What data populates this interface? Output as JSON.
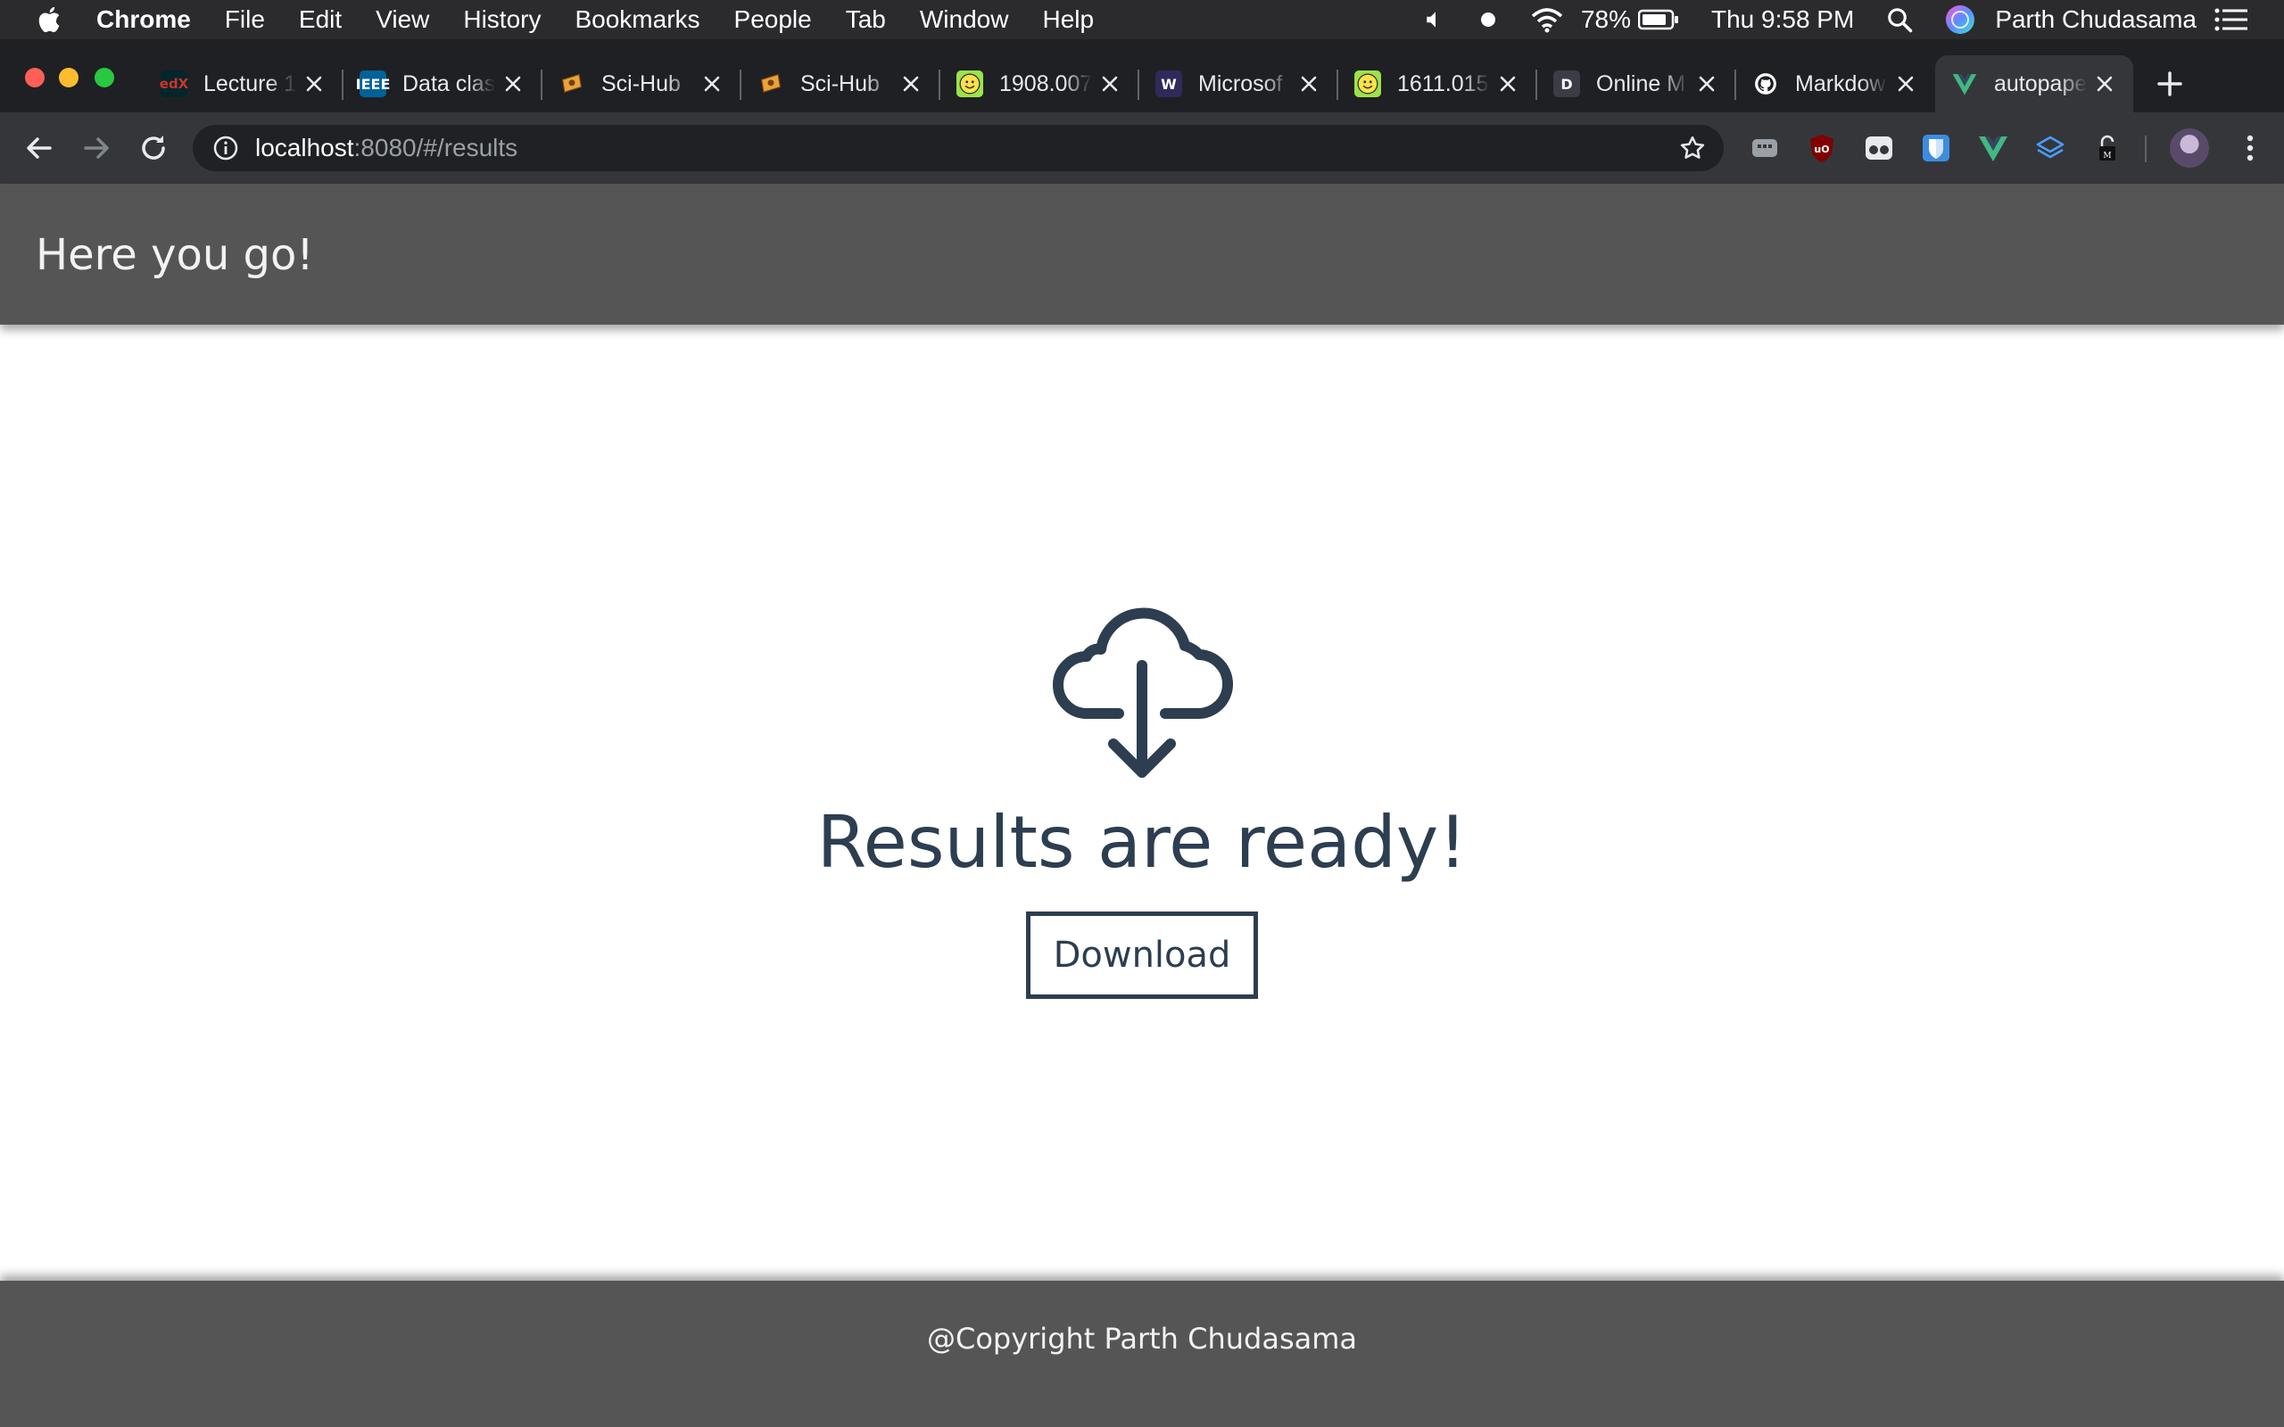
{
  "menubar": {
    "app_name": "Chrome",
    "items": [
      "File",
      "Edit",
      "View",
      "History",
      "Bookmarks",
      "People",
      "Tab",
      "Window",
      "Help"
    ],
    "battery": "78%",
    "clock": "Thu 9:58 PM",
    "user": "Parth Chudasama"
  },
  "tabs": [
    {
      "label": "Lecture 1",
      "favicon": "edx-icon",
      "favicon_text": "edX",
      "favicon_color": "#02262b"
    },
    {
      "label": "Data clas",
      "favicon": "ieee-icon",
      "favicon_text": "IEEE",
      "favicon_color": "#00629b"
    },
    {
      "label": "Sci-Hub",
      "favicon": "scihub-icon",
      "favicon_text": "",
      "favicon_color": "#e8a33a"
    },
    {
      "label": "Sci-Hub",
      "favicon": "scihub-icon",
      "favicon_text": "",
      "favicon_color": "#e8a33a"
    },
    {
      "label": "1908.007",
      "favicon": "smiley-icon",
      "favicon_text": "",
      "favicon_color": "#9be34a"
    },
    {
      "label": "Microsof",
      "favicon": "w-icon",
      "favicon_text": "W",
      "favicon_color": "#2f2a5a"
    },
    {
      "label": "1611.015",
      "favicon": "smiley-icon",
      "favicon_text": "",
      "favicon_color": "#9be34a"
    },
    {
      "label": "Online M",
      "favicon": "d-icon",
      "favicon_text": "D",
      "favicon_color": "#3c3c46"
    },
    {
      "label": "Markdow",
      "favicon": "github-icon",
      "favicon_text": "",
      "favicon_color": "#ffffff"
    },
    {
      "label": "autopape",
      "favicon": "vue-icon",
      "favicon_text": "",
      "favicon_color": "#41b883",
      "active": true
    }
  ],
  "address_bar": {
    "host": "localhost",
    "path": ":8080/#/results"
  },
  "page": {
    "header_title": "Here you go!",
    "headline": "Results are ready!",
    "download_label": "Download",
    "footer_text": "@Copyright Parth Chudasama"
  },
  "colors": {
    "accent": "#2c3e50",
    "header_bg": "#555555",
    "chrome_dark": "#35363a"
  }
}
